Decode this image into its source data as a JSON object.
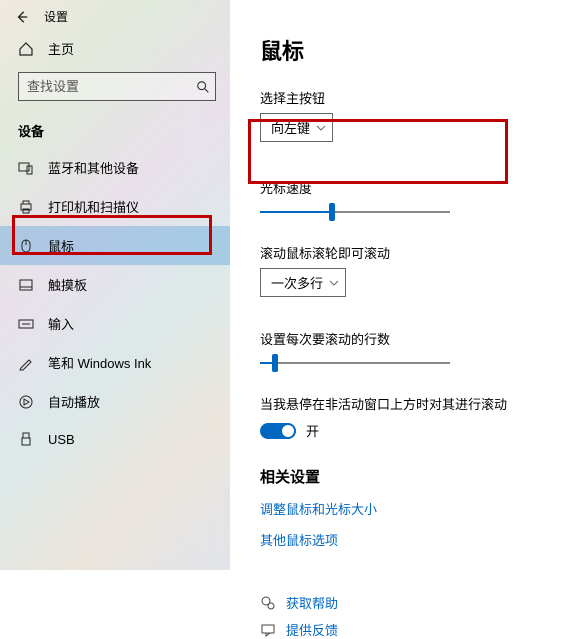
{
  "header": {
    "app_title": "设置"
  },
  "sidebar": {
    "home_label": "主页",
    "search_placeholder": "查找设置",
    "section_header": "设备",
    "items": [
      {
        "label": "蓝牙和其他设备"
      },
      {
        "label": "打印机和扫描仪"
      },
      {
        "label": "鼠标"
      },
      {
        "label": "触摸板"
      },
      {
        "label": "输入"
      },
      {
        "label": "笔和 Windows Ink"
      },
      {
        "label": "自动播放"
      },
      {
        "label": "USB"
      }
    ]
  },
  "main": {
    "title": "鼠标",
    "primary_button": {
      "label": "选择主按钮",
      "value": "向左键"
    },
    "cursor_speed": {
      "label": "光标速度",
      "value_pct": 38
    },
    "scroll_mode": {
      "label": "滚动鼠标滚轮即可滚动",
      "value": "一次多行"
    },
    "scroll_lines": {
      "label": "设置每次要滚动的行数",
      "value_pct": 8
    },
    "inactive_scroll": {
      "label": "当我悬停在非活动窗口上方时对其进行滚动",
      "state_label": "开"
    },
    "related": {
      "header": "相关设置",
      "links": [
        "调整鼠标和光标大小",
        "其他鼠标选项"
      ]
    },
    "help": {
      "get_help": "获取帮助",
      "feedback": "提供反馈"
    }
  },
  "colors": {
    "accent": "#0067c0",
    "highlight_border": "#c00000"
  }
}
